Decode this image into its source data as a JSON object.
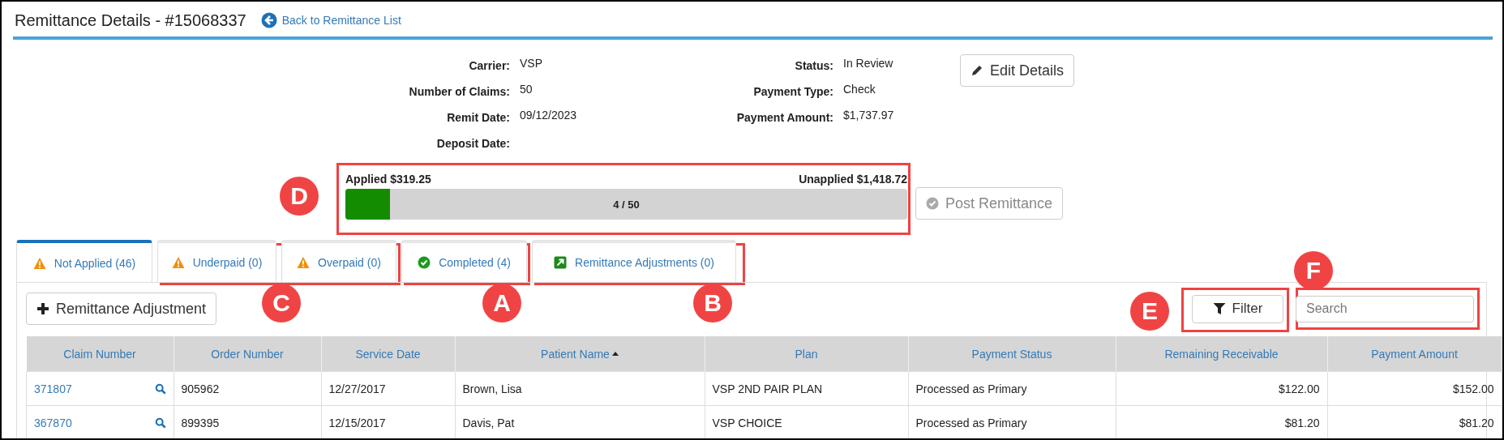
{
  "title": "Remittance Details - #15068337",
  "back_link": "Back to Remittance List",
  "details": [
    {
      "label": "Carrier:",
      "value": "VSP"
    },
    {
      "label": "Status:",
      "value": "In Review"
    },
    {
      "label": "Number of Claims:",
      "value": "50"
    },
    {
      "label": "Payment Type:",
      "value": "Check"
    },
    {
      "label": "Remit Date:",
      "value": "09/12/2023"
    },
    {
      "label": "Payment Amount:",
      "value": "$1,737.97"
    },
    {
      "label": "Deposit Date:"
    }
  ],
  "edit_button": "Edit Details",
  "progress": {
    "applied": "Applied $319.25",
    "unapplied": "Unapplied $1,418.72",
    "count": "4 / 50",
    "level": 0.08
  },
  "post_button": {
    "label": "Post Remittance",
    "disabled": true
  },
  "tabs": [
    {
      "label": "Not Applied (46)",
      "kind": "warning",
      "selected": true
    },
    {
      "label": "Underpaid (0)",
      "kind": "warning",
      "selected": false
    },
    {
      "label": "Overpaid (0)",
      "kind": "warning",
      "selected": false
    },
    {
      "label": "Completed (4)",
      "kind": "complete",
      "selected": false
    },
    {
      "label": "Remittance Adjustments (0)",
      "kind": "adjustment",
      "selected": false
    }
  ],
  "adjustment_button": "Remittance Adjustment",
  "filter_button": "Filter",
  "search": {
    "placeholder": "Search"
  },
  "table": {
    "columns": [
      {
        "label": "Claim Number",
        "sorted": false
      },
      {
        "label": "Order Number",
        "sorted": false
      },
      {
        "label": "Service Date",
        "sorted": false
      },
      {
        "label": "Patient Name",
        "sorted": true
      },
      {
        "label": "Plan",
        "sorted": false
      },
      {
        "label": "Payment Status",
        "sorted": false
      },
      {
        "label": "Remaining Receivable",
        "sorted": false
      },
      {
        "label": "Payment Amount",
        "sorted": false
      }
    ],
    "rows": [
      [
        "371807",
        "905962",
        "12/27/2017",
        "Brown, Lisa",
        "VSP 2ND PAIR PLAN",
        "Processed as Primary",
        "$122.00",
        "$152.00"
      ],
      [
        "367870",
        "899395",
        "12/15/2017",
        "Davis, Pat",
        "VSP CHOICE",
        "Processed as Primary",
        "$81.20",
        "$81.20"
      ]
    ]
  },
  "annotations": [
    {
      "letter": "D"
    },
    {
      "letter": "C"
    },
    {
      "letter": "A"
    },
    {
      "letter": "B"
    },
    {
      "letter": "E"
    },
    {
      "letter": "F"
    }
  ]
}
